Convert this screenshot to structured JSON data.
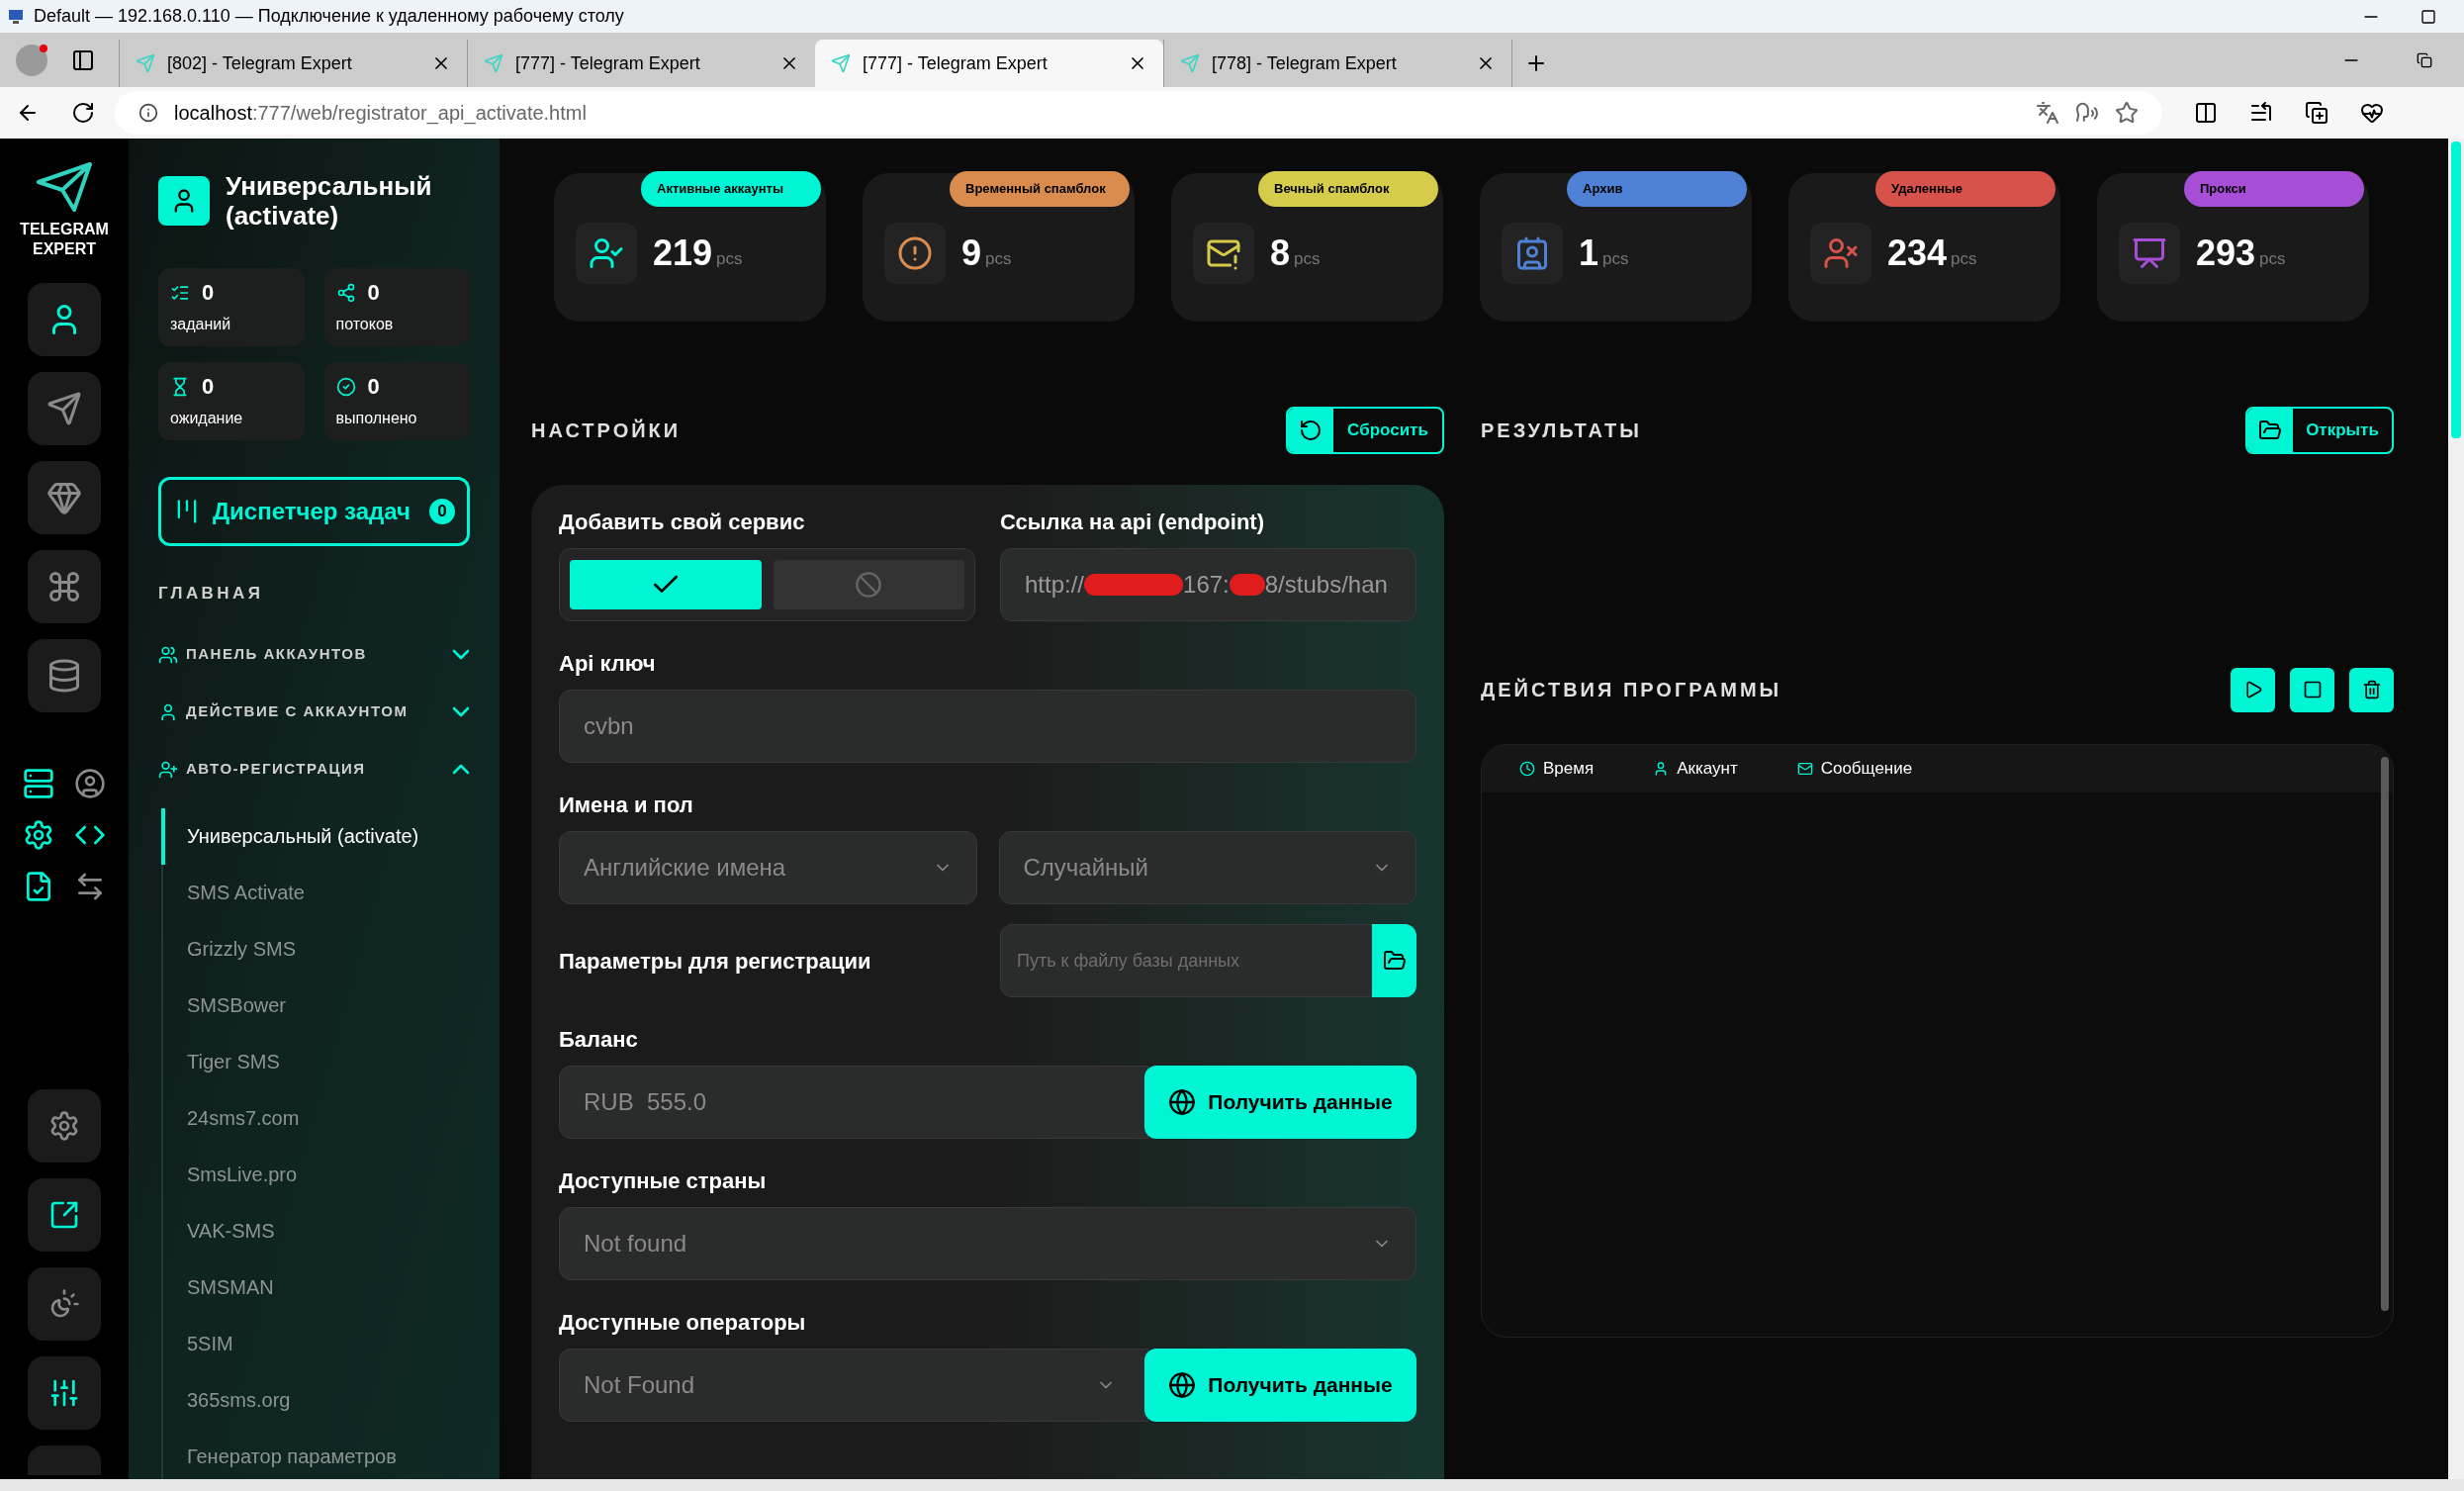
{
  "window": {
    "title": "Default — 192.168.0.110 — Подключение к удаленному рабочему столу"
  },
  "browser": {
    "tabs": [
      {
        "label": "[802] - Telegram Expert",
        "selected": false
      },
      {
        "label": "[777] - Telegram Expert",
        "selected": false
      },
      {
        "label": "[777] - Telegram Expert",
        "selected": true
      },
      {
        "label": "[778] - Telegram Expert",
        "selected": false
      }
    ],
    "address": {
      "host": "localhost",
      "path": ":777/web/registrator_api_activate.html"
    }
  },
  "brand": [
    "TELEGRAM",
    "EXPERT"
  ],
  "rail": [
    {
      "selected": true
    },
    {
      "selected": false
    },
    {
      "selected": false
    },
    {
      "selected": false
    },
    {
      "selected": false
    }
  ],
  "tools": [
    {
      "active": true
    },
    {
      "active": false
    },
    {
      "active": true
    },
    {
      "active": true
    },
    {
      "active": true
    },
    {
      "active": false
    }
  ],
  "rail_bottom": [
    {
      "active": false
    },
    {
      "active": true
    },
    {
      "active": false
    },
    {
      "active": true
    }
  ],
  "page": {
    "title": "Универсальный (activate)"
  },
  "counters": [
    {
      "value": "0",
      "label": "заданий"
    },
    {
      "value": "0",
      "label": "потоков"
    },
    {
      "value": "0",
      "label": "ожидание"
    },
    {
      "value": "0",
      "label": "выполнено"
    }
  ],
  "task_manager": {
    "label": "Диспетчер задач",
    "count": "0"
  },
  "nav": {
    "section": "ГЛАВНАЯ",
    "groups": [
      {
        "label": "ПАНЕЛЬ АККАУНТОВ",
        "expanded": false
      },
      {
        "label": "ДЕЙСТВИЕ С АККАУНТОМ",
        "expanded": false
      },
      {
        "label": "АВТО-РЕГИСТРАЦИЯ",
        "expanded": true,
        "children": [
          {
            "label": "Универсальный (activate)",
            "selected": true
          },
          {
            "label": "SMS Activate",
            "selected": false
          },
          {
            "label": "Grizzly SMS",
            "selected": false
          },
          {
            "label": "SMSBower",
            "selected": false
          },
          {
            "label": "Tiger SMS",
            "selected": false
          },
          {
            "label": "24sms7.com",
            "selected": false
          },
          {
            "label": "SmsLive.pro",
            "selected": false
          },
          {
            "label": "VAK-SMS",
            "selected": false
          },
          {
            "label": "SMSMAN",
            "selected": false
          },
          {
            "label": "5SIM",
            "selected": false
          },
          {
            "label": "365sms.org",
            "selected": false
          },
          {
            "label": "Генератор параметров",
            "selected": false
          }
        ]
      }
    ]
  },
  "stats": [
    {
      "label": "Активные аккаунты",
      "value": "219",
      "unit": "pcs",
      "color": "#00f5d4"
    },
    {
      "label": "Временный спамблок",
      "value": "9",
      "unit": "pcs",
      "color": "#d98c4e"
    },
    {
      "label": "Вечный спамблок",
      "value": "8",
      "unit": "pcs",
      "color": "#d6cc4c"
    },
    {
      "label": "Архив",
      "value": "1",
      "unit": "pcs",
      "color": "#4f82d6"
    },
    {
      "label": "Удаленные",
      "value": "234",
      "unit": "pcs",
      "color": "#d6524a"
    },
    {
      "label": "Прокси",
      "value": "293",
      "unit": "pcs",
      "color": "#a64fd6"
    }
  ],
  "settings": {
    "title": "НАСТРОЙКИ",
    "reset_button": "Сбросить",
    "own_service": {
      "label": "Добавить свой сервис",
      "enabled": true
    },
    "endpoint": {
      "label": "Ссылка на api (endpoint)",
      "value_parts": [
        "http://",
        "167:",
        "8/stubs/han"
      ]
    },
    "api_key": {
      "label": "Api ключ",
      "value": "cvbn"
    },
    "names": {
      "label": "Имена и пол",
      "language": "Английские имена",
      "gender": "Случайный"
    },
    "reg_params": {
      "label": "Параметры для регистрации",
      "placeholder": "Путь к файлу базы данных"
    },
    "balance": {
      "label": "Баланс",
      "value": "RUB  555.0",
      "button": "Получить данные"
    },
    "countries": {
      "label": "Доступные страны",
      "value": "Not found"
    },
    "operators": {
      "label": "Доступные операторы",
      "value": "Not Found",
      "button": "Получить данные"
    }
  },
  "results": {
    "title": "РЕЗУЛЬТАТЫ",
    "open_button": "Открыть"
  },
  "actions": {
    "title": "ДЕЙСТВИЯ ПРОГРАММЫ",
    "columns": [
      "Время",
      "Аккаунт",
      "Сообщение"
    ]
  }
}
